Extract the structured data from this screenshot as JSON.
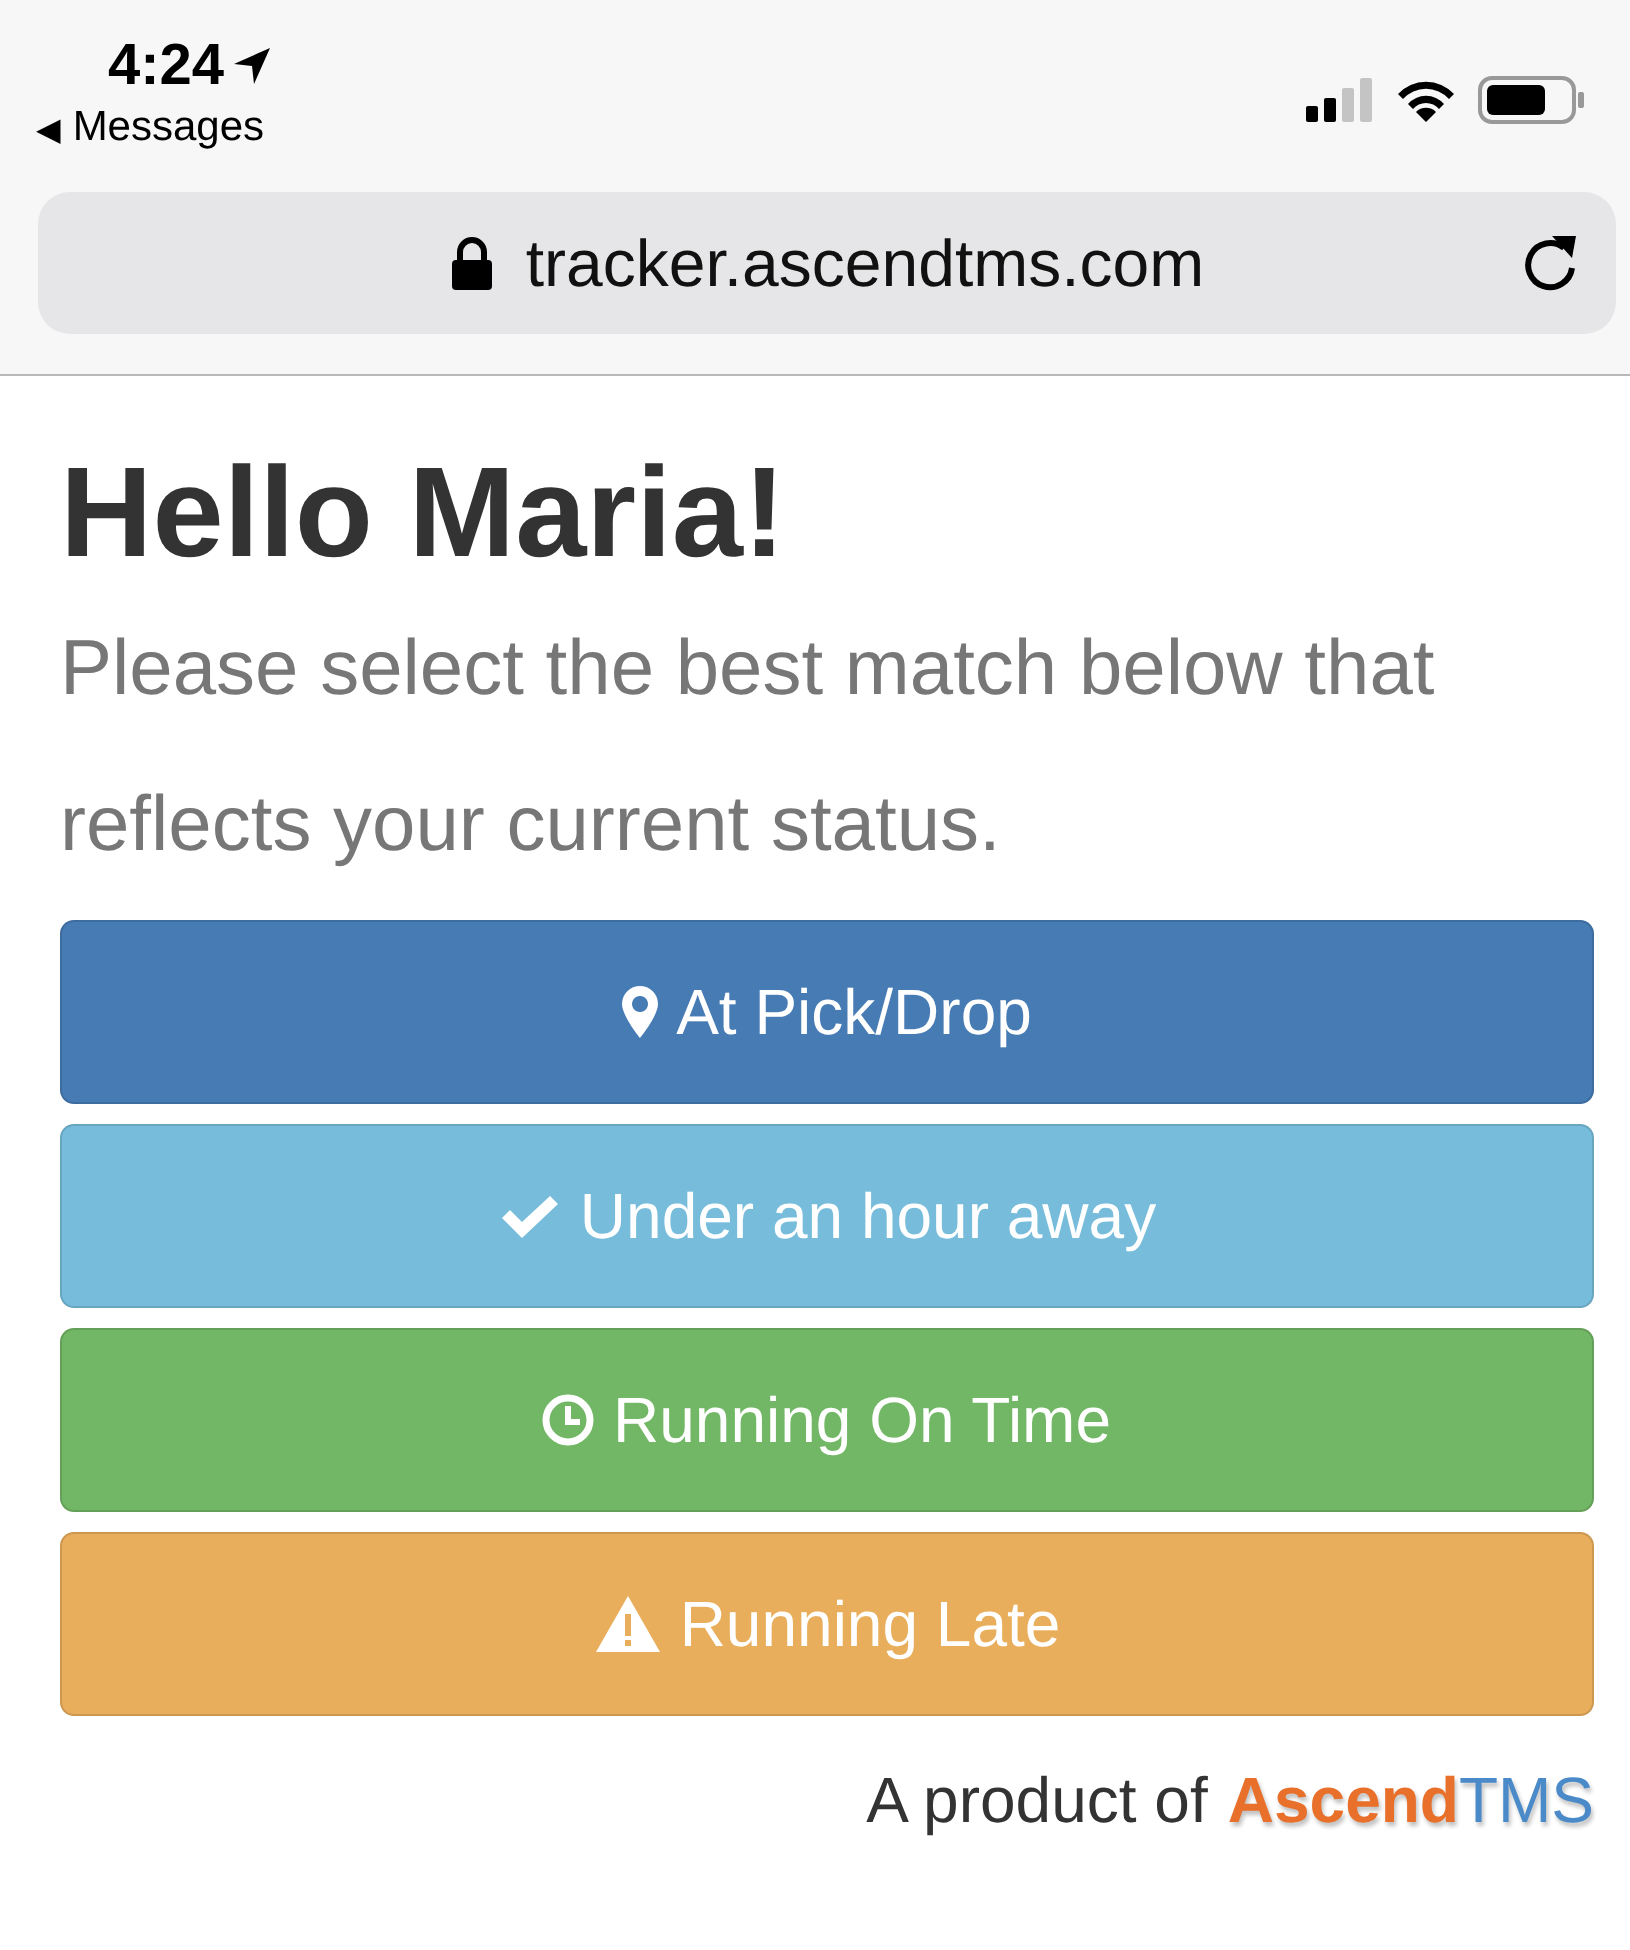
{
  "status_bar": {
    "time": "4:24",
    "back_arrow": "◀",
    "back_label": "Messages"
  },
  "address_bar": {
    "url": "tracker.ascendtms.com"
  },
  "heading": "Hello Maria!",
  "prompt": "Please select the best match below that reflects your current status.",
  "status_buttons": [
    {
      "label": "At Pick/Drop",
      "kind": "pin",
      "color": "#467bb4"
    },
    {
      "label": "Under an hour away",
      "kind": "check",
      "color": "#77bddb"
    },
    {
      "label": "Running On Time",
      "kind": "clock",
      "color": "#72b765"
    },
    {
      "label": "Running Late",
      "kind": "warning",
      "color": "#e9ae5c"
    }
  ],
  "footer": {
    "text": "A product of",
    "logo": [
      "Ascend",
      "TMS"
    ]
  }
}
